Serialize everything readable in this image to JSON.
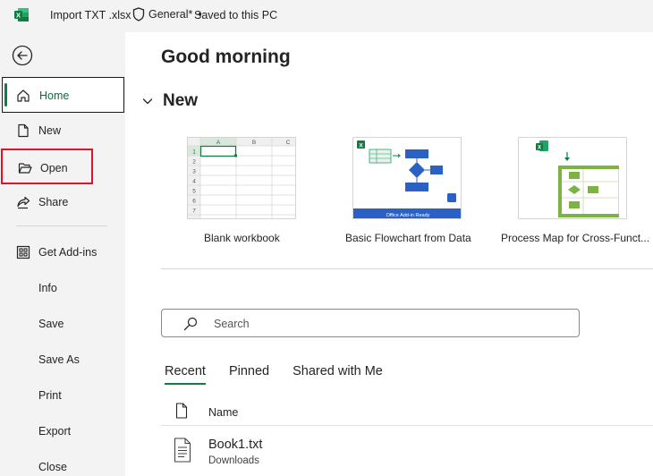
{
  "titlebar": {
    "file_name": "Import TXT .xlsx",
    "sensitivity": "General*",
    "separator": "•",
    "save_status": "Saved to this PC",
    "accent": "#107c41"
  },
  "sidebar": {
    "back_icon": "back-arrow-icon",
    "items": [
      {
        "label": "Home",
        "icon": "home-icon"
      },
      {
        "label": "New",
        "icon": "new-document-icon"
      },
      {
        "label": "Open",
        "icon": "folder-open-icon"
      },
      {
        "label": "Share",
        "icon": "share-icon"
      },
      {
        "label": "Get Add-ins",
        "icon": "add-ins-icon"
      },
      {
        "label": "Info"
      },
      {
        "label": "Save"
      },
      {
        "label": "Save As"
      },
      {
        "label": "Print"
      },
      {
        "label": "Export"
      },
      {
        "label": "Close"
      }
    ]
  },
  "main": {
    "greeting": "Good morning",
    "new_section": {
      "title": "New",
      "templates": [
        {
          "label": "Blank workbook"
        },
        {
          "label": "Basic Flowchart from Data",
          "banner": "Office Add-in Ready"
        },
        {
          "label": "Process Map for Cross-Funct..."
        }
      ]
    },
    "search": {
      "placeholder": "Search"
    },
    "tabs": [
      "Recent",
      "Pinned",
      "Shared with Me"
    ],
    "list": {
      "column_name": "Name",
      "rows": [
        {
          "name": "Book1.txt",
          "location": "Downloads"
        }
      ]
    }
  }
}
